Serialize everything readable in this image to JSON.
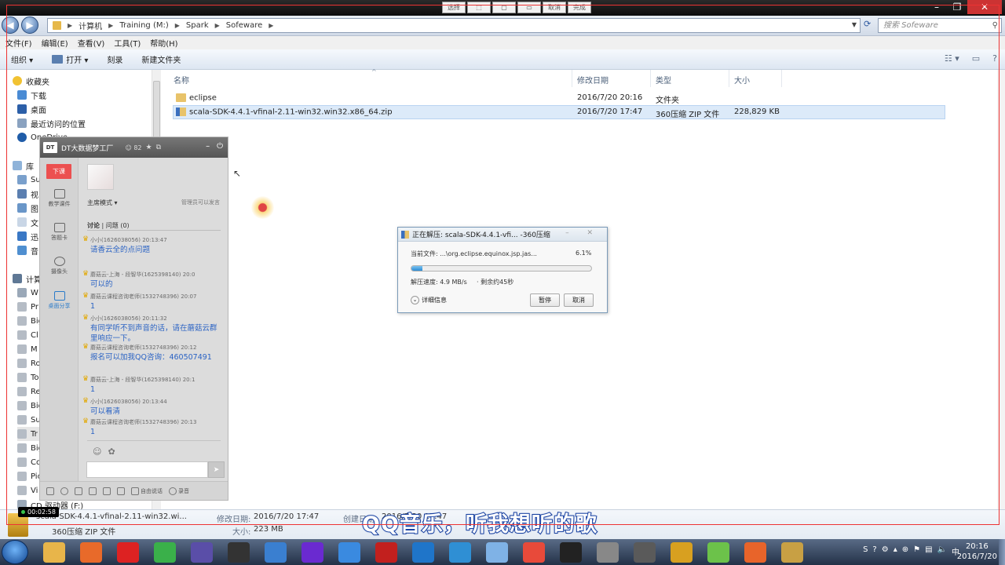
{
  "overlay_tools": [
    "选择",
    "",
    "",
    "",
    "取消",
    "完成"
  ],
  "address": {
    "crumbs": [
      "计算机",
      "Training (M:)",
      "Spark",
      "Sofeware"
    ],
    "search_placeholder": "搜索 Sofeware"
  },
  "menu": [
    "文件(F)",
    "编辑(E)",
    "查看(V)",
    "工具(T)",
    "帮助(H)"
  ],
  "toolbar": {
    "organize": "组织 ▾",
    "open": "打开 ▾",
    "burn": "刻录",
    "new_folder": "新建文件夹"
  },
  "nav": {
    "favorites": "收藏夹",
    "downloads": "下载",
    "desktop": "桌面",
    "recent": "最近访问的位置",
    "onedrive": "OneDrive",
    "libraries": "库",
    "lib_items": [
      "Su",
      "视",
      "图",
      "文",
      "迅",
      "音"
    ],
    "computer": "计算机",
    "comp_items": [
      "W",
      "Pr",
      "Big",
      "Cl",
      "M",
      "Ro",
      "To",
      "Re",
      "Big",
      "Su",
      "Tr",
      "Big",
      "Co",
      "Pic",
      "Vi"
    ],
    "cd_drive": "CD 驱动器 (F:)"
  },
  "columns": {
    "name": "名称",
    "modified": "修改日期",
    "type": "类型",
    "size": "大小"
  },
  "files": [
    {
      "name": "eclipse",
      "modified": "2016/7/20 20:16",
      "type": "文件夹",
      "size": ""
    },
    {
      "name": "scala-SDK-4.4.1-vfinal-2.11-win32.win32.x86_64.zip",
      "modified": "2016/7/20 17:47",
      "type": "360压缩 ZIP 文件",
      "size": "228,829 KB"
    }
  ],
  "dialog": {
    "title": "正在解压: scala-SDK-4.4.1-vfi... -360压缩",
    "current_label": "当前文件: ...\\org.eclipse.equinox.jsp.jas...",
    "percent": "6.1%",
    "progress": 0.061,
    "speed": "解压速度: 4.9 MB/s",
    "remaining": "· 剩余约45秒",
    "details": "详细信息",
    "pause": "暂停",
    "cancel": "取消"
  },
  "dt": {
    "title": "DT大数据梦工厂",
    "count": "82",
    "xiake": "下课",
    "side": [
      "教学课件",
      "答题卡",
      "摄像头",
      "桌面分享"
    ],
    "mode": "主席模式 ▾",
    "admin_only": "管理员可以发言",
    "tab_discuss": "讨论",
    "tab_qa": "问题 (0)",
    "messages": [
      {
        "who": "小小(1626038056) 20:13:47",
        "text": "请香云全的点问题"
      },
      {
        "who": "蘑菇云-上海 - 段智华(1625398140) 20:0",
        "text": "可以的"
      },
      {
        "who": "蘑菇云课程咨询老师(1532748396) 20:07",
        "text": "1"
      },
      {
        "who": "小小(1626038056) 20:11:32",
        "text": "有同学听不到声音的话，请在蘑菇云群里响应一下。"
      },
      {
        "who": "蘑菇云课程咨询老师(1532748396) 20:12",
        "text": "报名可以加我QQ咨询：460507491"
      },
      {
        "who": "蘑菇云-上海 - 段智华(1625398140) 20:1",
        "text": "1"
      },
      {
        "who": "小小(1626038056) 20:13:44",
        "text": "可以看清"
      },
      {
        "who": "蘑菇云课程咨询老师(1532748396) 20:13",
        "text": "1"
      }
    ],
    "free_talk": "自由说话",
    "record": "录音"
  },
  "details_pane": {
    "filename": "scala-SDK-4.4.1-vfinal-2.11-win32.wi...",
    "filetype": "360压缩 ZIP 文件",
    "modified_label": "修改日期:",
    "modified_value": "2016/7/20 17:47",
    "size_label": "大小:",
    "size_value": "223 MB",
    "created_label": "创建日期:",
    "created_value": "2016/7/20 17:47"
  },
  "timer": "00:02:58",
  "subtitle": "QQ音乐，听我想听的歌",
  "clock": {
    "time": "20:16",
    "date": "2016/7/20"
  },
  "taskbar_icons": [
    "explorer-icon",
    "firefox-icon",
    "recorder-icon",
    "wechat-icon",
    "eclipse-icon",
    "terminal-icon",
    "app-icon",
    "intellij-icon",
    "feather-icon",
    "ev-icon",
    "k-icon",
    "network-icon",
    "globe-icon",
    "chrome-icon",
    "qq-icon",
    "camera-icon",
    "vs-icon",
    "game-icon",
    "player-icon",
    "slides-icon",
    "archive-icon"
  ],
  "colors": {
    "accent": "#2b63c4",
    "progress": "#2c8bd4",
    "xiake": "#ec5050",
    "subtitle_outline": "#153d9a"
  }
}
